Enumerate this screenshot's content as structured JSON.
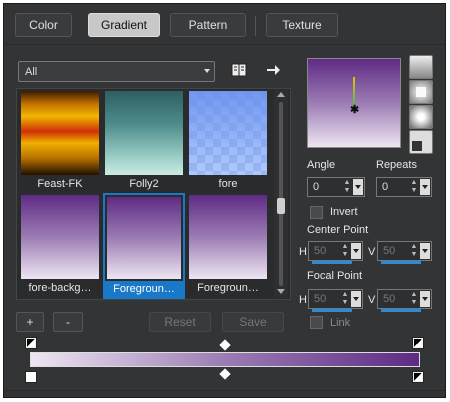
{
  "tabs": [
    {
      "label": "Color",
      "active": false
    },
    {
      "label": "Gradient",
      "active": true
    },
    {
      "label": "Pattern",
      "active": false
    },
    {
      "label": "Texture",
      "active": false
    }
  ],
  "category_select": {
    "value": "All"
  },
  "tiles": [
    {
      "label": "Feast-FK",
      "selected": false
    },
    {
      "label": "Folly2",
      "selected": false
    },
    {
      "label": "fore",
      "selected": false
    },
    {
      "label": "fore-backg…",
      "selected": false
    },
    {
      "label": "Foregroun…",
      "selected": true
    },
    {
      "label": "Foregroun…",
      "selected": false
    }
  ],
  "buttons": {
    "add": "+",
    "remove": "-",
    "reset": "Reset",
    "save": "Save"
  },
  "angle": {
    "label": "Angle",
    "value": "0"
  },
  "repeats": {
    "label": "Repeats",
    "value": "0"
  },
  "invert": {
    "label": "Invert",
    "checked": false
  },
  "center_point": {
    "label": "Center Point",
    "h_label": "H",
    "h_value": "50",
    "v_label": "V",
    "v_value": "50"
  },
  "focal_point": {
    "label": "Focal Point",
    "h_label": "H",
    "h_value": "50",
    "v_label": "V",
    "v_value": "50"
  },
  "link": {
    "label": "Link",
    "checked": false
  },
  "colors": {
    "purple": "#5e2b84",
    "light": "#e8e0ee",
    "accent": "#1a78c8"
  },
  "icons": {
    "library": "book-icon",
    "apply": "arrow-right-icon"
  }
}
